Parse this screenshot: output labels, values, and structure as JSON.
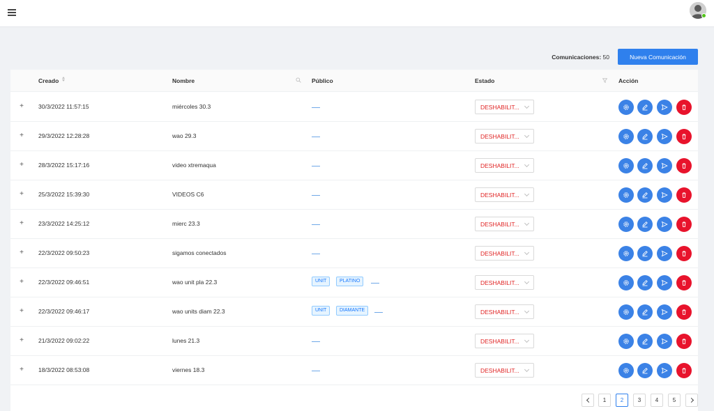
{
  "header": {
    "menu_icon": "hamburger-icon",
    "avatar_icon": "user-avatar-icon"
  },
  "toolbar": {
    "count_label": "Comunicaciones:",
    "count_value": "50",
    "new_button_label": "Nueva Comunicación"
  },
  "table": {
    "columns": {
      "created": "Creado",
      "name": "Nombre",
      "public": "Público",
      "status": "Estado",
      "action": "Acción"
    },
    "expand_label": "+",
    "status_value": "DESHABILIT...",
    "action_icons": [
      "settings-icon",
      "edit-icon",
      "send-icon",
      "delete-icon"
    ],
    "rows": [
      {
        "created": "30/3/2022 11:57:15",
        "name": "miércoles 30.3",
        "tags": []
      },
      {
        "created": "29/3/2022 12:28:28",
        "name": "wao 29.3",
        "tags": []
      },
      {
        "created": "28/3/2022 15:17:16",
        "name": "video xtremaqua",
        "tags": []
      },
      {
        "created": "25/3/2022 15:39:30",
        "name": "VIDEOS C6",
        "tags": []
      },
      {
        "created": "23/3/2022 14:25:12",
        "name": "mierc 23.3",
        "tags": []
      },
      {
        "created": "22/3/2022 09:50:23",
        "name": "sigamos conectados",
        "tags": []
      },
      {
        "created": "22/3/2022 09:46:51",
        "name": "wao unit pla 22.3",
        "tags": [
          "UNIT",
          "PLATINO"
        ]
      },
      {
        "created": "22/3/2022 09:46:17",
        "name": "wao units diam 22.3",
        "tags": [
          "UNIT",
          "DIAMANTE"
        ]
      },
      {
        "created": "21/3/2022 09:02:22",
        "name": "lunes 21.3",
        "tags": []
      },
      {
        "created": "18/3/2022 08:53:08",
        "name": "viernes 18.3",
        "tags": []
      }
    ]
  },
  "pagination": {
    "pages": [
      "1",
      "2",
      "3",
      "4",
      "5"
    ],
    "current": "2"
  },
  "colors": {
    "primary": "#2f80ed",
    "danger": "#e8132c",
    "status_text": "#e02424"
  }
}
